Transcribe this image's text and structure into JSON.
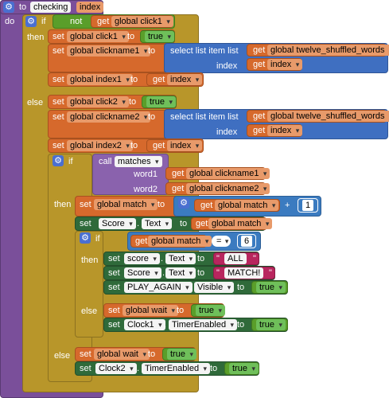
{
  "proc": {
    "keyword": "to",
    "name": "checking",
    "param": "index",
    "do": "do"
  },
  "ifkw": "if",
  "thenkw": "then",
  "elsekw": "else",
  "set": "set",
  "get": "get",
  "to": "to",
  "not": "not",
  "index": "index",
  "true": "true",
  "select": "select list item  list",
  "call": "call",
  "vars": {
    "click1": "global click1",
    "click2": "global click2",
    "clickname1": "global clickname1",
    "clickname2": "global clickname2",
    "index1": "global index1",
    "index2": "global index2",
    "twelve": "global twelve_shuffled_words",
    "match": "global match",
    "wait": "global wait"
  },
  "matches": {
    "name": "matches",
    "p1": "word1",
    "p2": "word2"
  },
  "plus": "+",
  "one": "1",
  "eq": "=",
  "six": "6",
  "comps": {
    "score": "Score",
    "score_lower": "score",
    "text": "Text",
    "play_again": "PLAY_AGAIN",
    "visible": "Visible",
    "clock1": "Clock1",
    "clock2": "Clock2",
    "timer": "TimerEnabled"
  },
  "strings": {
    "all": "ALL",
    "match": "MATCH!"
  },
  "quote": "\"",
  "dot": "."
}
